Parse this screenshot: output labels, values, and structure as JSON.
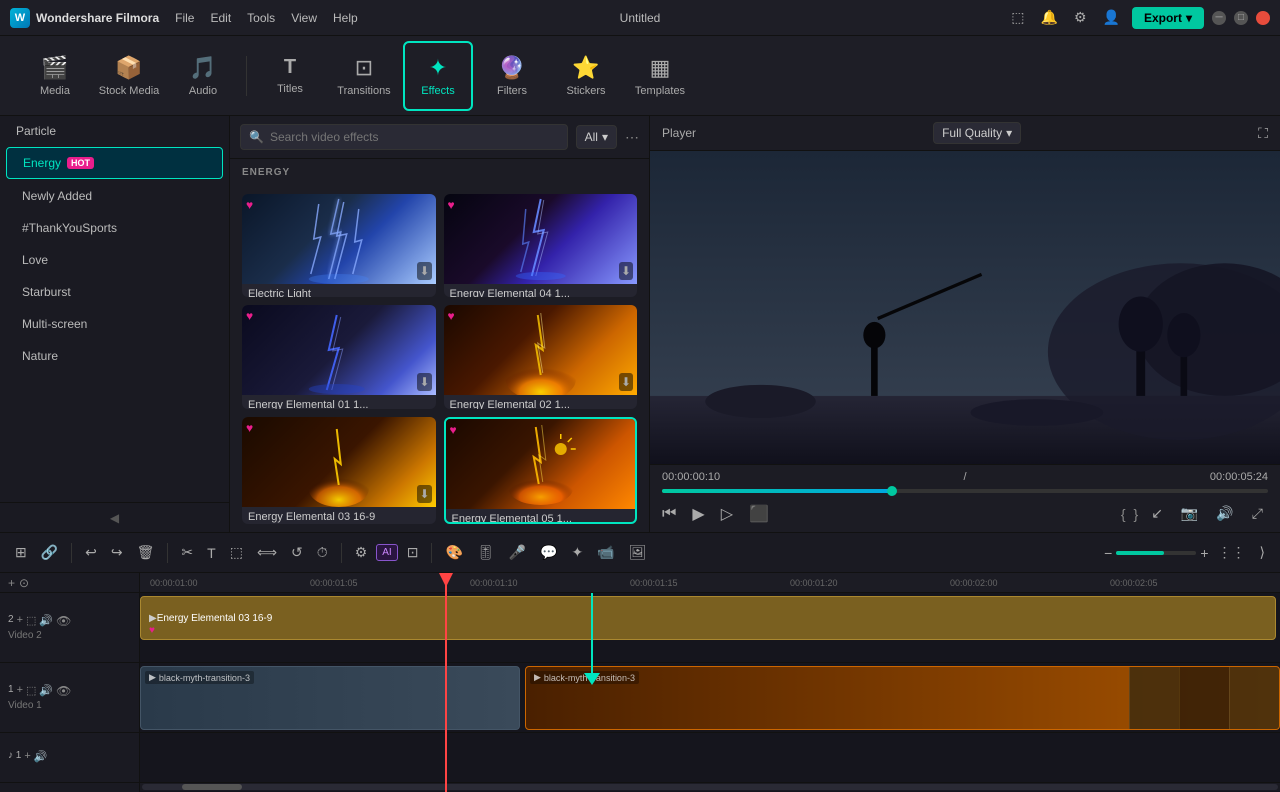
{
  "app": {
    "name": "Wondershare Filmora",
    "title": "Untitled",
    "export_label": "Export"
  },
  "menu": {
    "items": [
      "File",
      "Edit",
      "Tools",
      "View",
      "Help"
    ]
  },
  "toolbar": {
    "items": [
      {
        "id": "media",
        "label": "Media",
        "icon": "🎬"
      },
      {
        "id": "stock_media",
        "label": "Stock Media",
        "icon": "📦"
      },
      {
        "id": "audio",
        "label": "Audio",
        "icon": "🎵"
      },
      {
        "id": "titles",
        "label": "Titles",
        "icon": "T"
      },
      {
        "id": "transitions",
        "label": "Transitions",
        "icon": "⊡"
      },
      {
        "id": "effects",
        "label": "Effects",
        "icon": "✦"
      },
      {
        "id": "filters",
        "label": "Filters",
        "icon": "🔮"
      },
      {
        "id": "stickers",
        "label": "Stickers",
        "icon": "⭐"
      },
      {
        "id": "templates",
        "label": "Templates",
        "icon": "▦"
      }
    ]
  },
  "sidebar": {
    "top_item": "Particle",
    "active_item": "Energy",
    "hot_badge": "HOT",
    "items": [
      "Newly Added",
      "#ThankYouSports",
      "Love",
      "Starburst",
      "Multi-screen",
      "Nature"
    ]
  },
  "search": {
    "placeholder": "Search video effects",
    "filter_label": "All"
  },
  "effects": {
    "section_label": "ENERGY",
    "items": [
      {
        "name": "Electric Light",
        "thumb_class": "effect-thumb-electric",
        "fav": true,
        "download": true,
        "selected": false
      },
      {
        "name": "Energy Elemental 04 1...",
        "thumb_class": "effect-thumb-elemental4",
        "fav": true,
        "download": true,
        "selected": false
      },
      {
        "name": "Energy Elemental 01 1...",
        "thumb_class": "effect-thumb-elemental1",
        "fav": true,
        "download": true,
        "selected": false
      },
      {
        "name": "Energy Elemental 02 1...",
        "thumb_class": "effect-thumb-elemental2",
        "fav": true,
        "download": true,
        "selected": false
      },
      {
        "name": "Energy Elemental 03 16-9",
        "thumb_class": "effect-thumb-elemental3",
        "fav": true,
        "download": true,
        "selected": false
      },
      {
        "name": "Energy Elemental 05 1...",
        "thumb_class": "effect-thumb-elemental5",
        "fav": true,
        "download": false,
        "selected": true
      }
    ]
  },
  "player": {
    "label": "Player",
    "quality": "Full Quality",
    "current_time": "00:00:00:10",
    "total_time": "00:00:05:24",
    "progress_pct": 38
  },
  "timeline": {
    "tracks": [
      {
        "id": "video2",
        "name": "Video 2",
        "num": 2
      },
      {
        "id": "video1",
        "name": "Video 1",
        "num": 1
      },
      {
        "id": "audio1",
        "name": "♪ 1",
        "num": 1
      }
    ],
    "time_marks": [
      "00:00:01:00",
      "00:00:01:05",
      "00:00:01:10",
      "00:00:01:15",
      "00:00:01:20",
      "00:00:02:00",
      "00:00:02:05"
    ],
    "effect_clip": "Energy Elemental 03 16-9",
    "video_clip_dark": "black-myth-transition-3",
    "video_clip_fire": "black-myth-transition-3"
  }
}
